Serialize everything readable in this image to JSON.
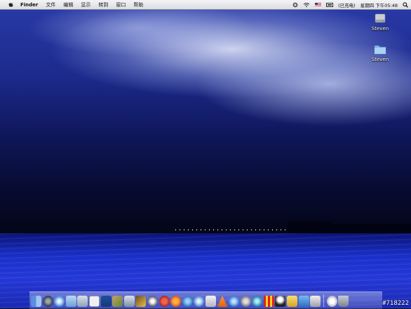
{
  "menubar": {
    "apple_icon": "apple-menu-icon",
    "app_name": "Finder",
    "items": [
      "文件",
      "编辑",
      "显示",
      "转到",
      "窗口",
      "帮助"
    ],
    "status": {
      "input_source_icon": "input-menu-icon",
      "flag_icon": "us-flag-icon",
      "battery_text": "(已充电)",
      "clock": "星期四 下午05:48",
      "spotlight_icon": "spotlight-icon"
    }
  },
  "desktop": {
    "icons": [
      {
        "label": "Steven",
        "icon": "hard-drive-icon"
      },
      {
        "label": "Steven",
        "icon": "folder-icon"
      }
    ]
  },
  "dock": {
    "items": [
      "finder-icon",
      "dashboard-icon",
      "safari-icon",
      "mail-icon",
      "address-book-icon",
      "app-store-icon",
      "ical-icon",
      "iphoto-icon",
      "itunes-icon",
      "preview-icon",
      "quicktime-icon",
      "firefox-icon",
      "chrome-icon",
      "network-icon",
      "globe-icon",
      "messages-icon",
      "vlc-icon",
      "forward-icon",
      "system-prefs-icon",
      "photobooth-icon",
      "qq-icon",
      "messenger-icon",
      "folder-icon",
      "utilities-icon",
      "trash-icon"
    ]
  },
  "watermark": "#718222",
  "colors": {
    "menubar_bg": "#e8e8ec",
    "sea": "#1f34cc",
    "sky": "#1c2a8c"
  }
}
